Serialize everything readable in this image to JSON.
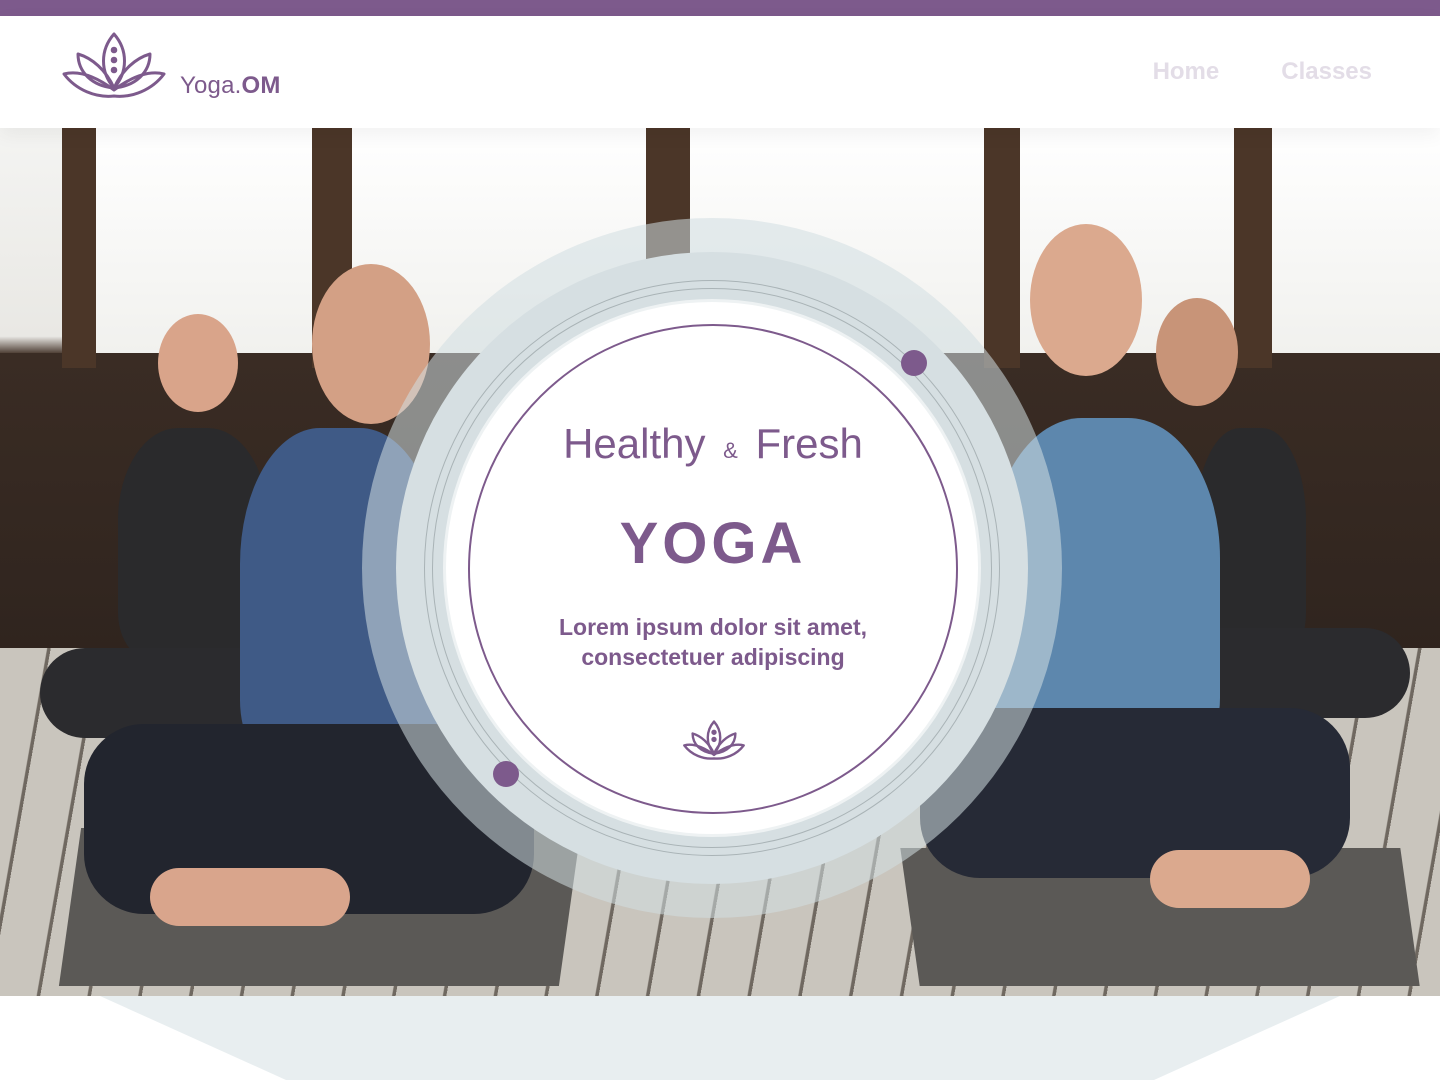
{
  "brand": {
    "name_regular": "Yoga.",
    "name_bold": "OM",
    "accent_color": "#7d5a8c",
    "logo_icon": "lotus-icon"
  },
  "nav": {
    "items": [
      {
        "label": "Home"
      },
      {
        "label": "Classes"
      }
    ]
  },
  "hero": {
    "tagline_left": "Healthy",
    "tagline_amp": "&",
    "tagline_right": "Fresh",
    "headline": "YOGA",
    "description_line1": "Lorem ipsum dolor sit amet,",
    "description_line2": "consectetuer adipiscing",
    "badge_icon": "lotus-icon",
    "photo": "people meditating in lotus pose"
  }
}
